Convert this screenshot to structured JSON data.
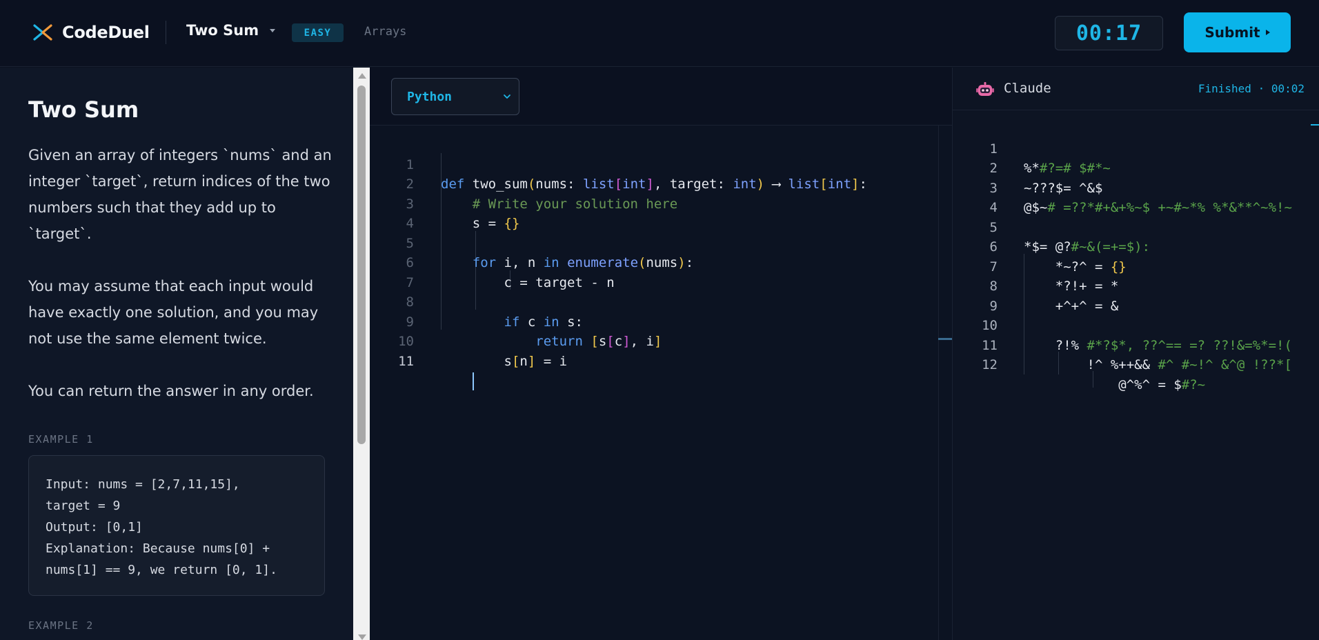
{
  "header": {
    "app_name": "CodeDuel",
    "problem_title": "Two Sum",
    "difficulty": "EASY",
    "tag": "Arrays",
    "timer": "00:17",
    "submit_label": "Submit"
  },
  "description": {
    "title": "Two Sum",
    "paragraphs": [
      "Given an array of integers `nums` and an integer `target`, return indices of the two numbers such that they add up to `target`.",
      "You may assume that each input would have exactly one solution, and you may not use the same element twice.",
      "You can return the answer in any order."
    ],
    "examples": [
      {
        "label": "EXAMPLE 1",
        "text": "Input: nums = [2,7,11,15],\ntarget = 9\nOutput: [0,1]\nExplanation: Because nums[0] +\nnums[1] == 9, we return [0, 1]."
      },
      {
        "label": "EXAMPLE 2"
      }
    ]
  },
  "editor": {
    "language": "Python",
    "line_numbers": [
      "1",
      "2",
      "3",
      "4",
      "5",
      "6",
      "7",
      "8",
      "9",
      "10",
      "11"
    ]
  },
  "opponent": {
    "name": "Claude",
    "status": "Finished · 00:02",
    "line_numbers": [
      "1",
      "2",
      "3",
      "4",
      "5",
      "6",
      "7",
      "8",
      "9",
      "10",
      "11",
      "12"
    ]
  },
  "colors": {
    "accent": "#0ab4ea",
    "background": "#0b1120",
    "panel": "#0f1727",
    "keyword": "#5b9cf0",
    "comment": "#6a9955",
    "bracket_yellow": "#f2c94c",
    "bracket_magenta": "#d25bd6"
  }
}
